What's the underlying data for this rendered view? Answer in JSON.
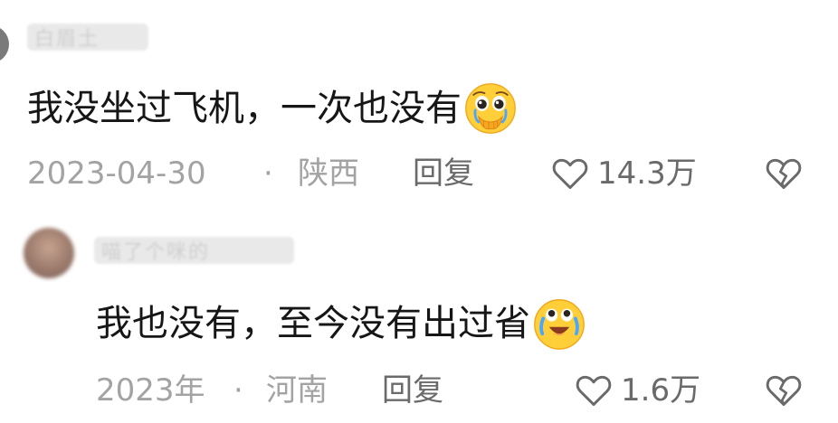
{
  "comments": [
    {
      "username": "白眉土",
      "text": "我没坐过飞机，一次也没有",
      "emoji": "crying-pleading-face",
      "date": "2023-04-30",
      "separator": "·",
      "location": "陕西",
      "reply_label": "回复",
      "likes": "14.3万"
    },
    {
      "username": "喵了个咪的",
      "text": "我也没有，至今没有出过省",
      "emoji": "crying-laughing-face",
      "date": "2023年",
      "separator": "·",
      "location": "河南",
      "reply_label": "回复",
      "likes": "1.6万"
    }
  ],
  "colors": {
    "text": "#161616",
    "meta": "#a3a3a3",
    "action": "#6a6a6a",
    "emoji_yellow": "#ffcf3a"
  }
}
